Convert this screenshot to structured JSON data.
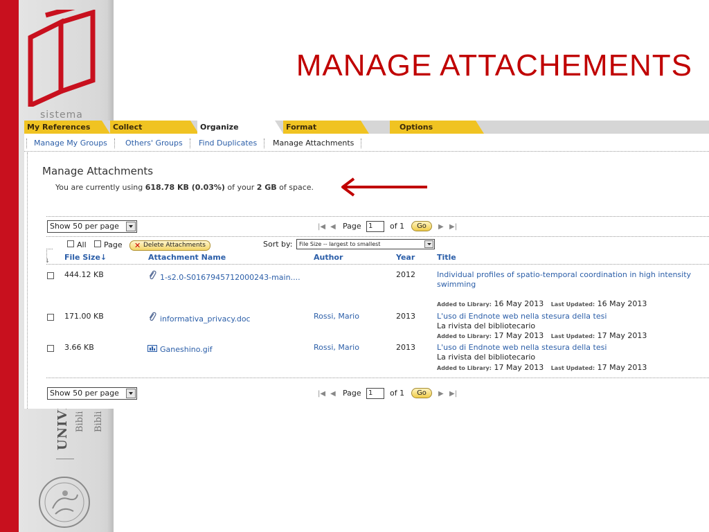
{
  "slide": {
    "title": "MANAGE ATTACHEMENTS",
    "branding": {
      "sistema": "sistema",
      "univ_main": "UNIVE",
      "univ_sub": [
        "Bibli",
        "Bibli"
      ]
    }
  },
  "main_nav": {
    "tabs": [
      {
        "label": "My References",
        "active": false
      },
      {
        "label": "Collect",
        "active": false
      },
      {
        "label": "Organize",
        "active": true
      },
      {
        "label": "Format",
        "active": false
      },
      {
        "label": "Options",
        "active": false
      }
    ]
  },
  "sub_nav": {
    "items": [
      "Manage My Groups",
      "Others' Groups",
      "Find Duplicates",
      "Manage Attachments"
    ]
  },
  "page": {
    "heading": "Manage Attachments",
    "usage": {
      "prefix": "You are currently using ",
      "used": "618.78 KB (0.03%)",
      "middle": " of your ",
      "total": "2 GB",
      "suffix": " of space."
    }
  },
  "pagination": {
    "per_page": "Show 50 per page",
    "page_label": "Page",
    "page_value": "1",
    "of_label": "of 1",
    "go_label": "Go"
  },
  "toolbar": {
    "select_all": "All",
    "select_page": "Page",
    "delete_label": "Delete Attachments",
    "sort_label": "Sort by:",
    "sort_value": "File Size -- largest to smallest"
  },
  "table": {
    "headers": {
      "file_size": "File Size",
      "attachment_name": "Attachment Name",
      "author": "Author",
      "year": "Year",
      "title": "Title"
    },
    "rows": [
      {
        "size": "444.12 KB",
        "name": "1-s2.0-S0167945712000243-main....",
        "icon": "paperclip-icon",
        "author": "",
        "year": "2012",
        "title_line1": "Individual profiles of spatio-temporal coordination in high intensity",
        "title_line2": "swimming",
        "journal": "",
        "added_label": "Added to Library:",
        "added": "16 May 2013",
        "updated_label": "Last Updated:",
        "updated": "16 May 2013"
      },
      {
        "size": "171.00 KB",
        "name": "informativa_privacy.doc",
        "icon": "paperclip-icon",
        "author": "Rossi, Mario",
        "year": "2013",
        "title_line1": "L'uso di Endnote web nella stesura della tesi",
        "journal": "La rivista del bibliotecario",
        "added_label": "Added to Library:",
        "added": "17 May 2013",
        "updated_label": "Last Updated:",
        "updated": "17 May 2013"
      },
      {
        "size": "3.66 KB",
        "name": "Ganeshino.gif",
        "icon": "image-file-icon",
        "author": "Rossi, Mario",
        "year": "2013",
        "title_line1": "L'uso di Endnote web nella stesura della tesi",
        "journal": "La rivista del bibliotecario",
        "added_label": "Added to Library:",
        "added": "17 May 2013",
        "updated_label": "Last Updated:",
        "updated": "17 May 2013"
      }
    ]
  },
  "colors": {
    "accent_red": "#c00000",
    "strip_red": "#c8101e",
    "tab_yellow": "#f0c322",
    "link_blue": "#2b5ea8"
  }
}
